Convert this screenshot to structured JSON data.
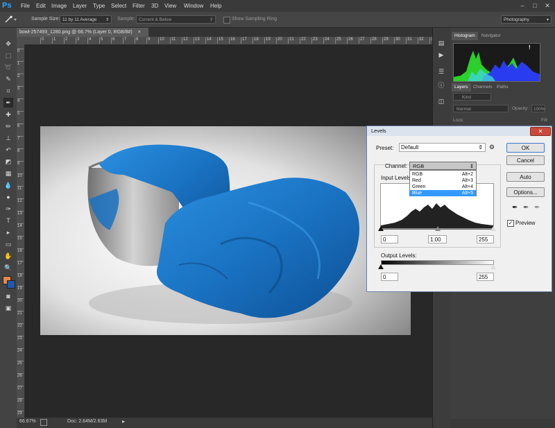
{
  "app": {
    "logo": "Ps",
    "menu": [
      "File",
      "Edit",
      "Image",
      "Layer",
      "Type",
      "Select",
      "Filter",
      "3D",
      "View",
      "Window",
      "Help"
    ],
    "window_controls": [
      "–",
      "□",
      "✕"
    ]
  },
  "options": {
    "sample_size_label": "Sample Size:",
    "sample_size_value": "11 by 11 Average",
    "sample_label": "Sample:",
    "sample_value": "Current & Below",
    "show_ring_label": "Show Sampling Ring",
    "workspace": "Photography"
  },
  "document": {
    "tab_title": "bowl-257493_1280.png @ 66.7% (Layer 0, RGB/8#)",
    "tab_close": "×",
    "ruler_h": [
      "0",
      "1",
      "2",
      "3",
      "4",
      "5",
      "6",
      "7",
      "8",
      "9",
      "10",
      "11",
      "12",
      "13",
      "14",
      "15",
      "16",
      "17",
      "18",
      "19",
      "20",
      "21",
      "22",
      "23",
      "24",
      "25",
      "26",
      "27",
      "28",
      "29",
      "30",
      "31",
      "32",
      "33"
    ],
    "ruler_v": [
      "0",
      "1",
      "2",
      "3",
      "4",
      "5",
      "6",
      "7",
      "8",
      "9",
      "10",
      "11",
      "12",
      "13",
      "14",
      "15",
      "16",
      "17",
      "18",
      "19",
      "20",
      "21",
      "22",
      "23",
      "24",
      "25",
      "26",
      "27",
      "28",
      "29"
    ]
  },
  "status": {
    "zoom": "66.67%",
    "doc_info": "Doc: 2.64M/2.63M",
    "arrow": "▸"
  },
  "panels": {
    "tabs_top": [
      "Histogram",
      "Navigator"
    ],
    "tabs_layers": [
      "Layers",
      "Channels",
      "Paths"
    ],
    "kind_label": "Kind",
    "blend_mode": "Normal",
    "opacity_label": "Opacity:",
    "opacity_value": "100%",
    "lock_label": "Lock:",
    "fill_label": "Fill:",
    "fill_value": "100%",
    "warning_icon": "!"
  },
  "levels": {
    "title": "Levels",
    "close": "✕",
    "preset_label": "Preset:",
    "preset_value": "Default",
    "channel_label": "Channel:",
    "channel_value": "RGB",
    "channel_options": [
      {
        "name": "RGB",
        "shortcut": "Alt+2"
      },
      {
        "name": "Red",
        "shortcut": "Alt+3"
      },
      {
        "name": "Green",
        "shortcut": "Alt+4"
      },
      {
        "name": "Blue",
        "shortcut": "Alt+5"
      }
    ],
    "selected_channel": "Blue",
    "input_levels_label": "Input Levels:",
    "input_black": "0",
    "input_gamma": "1.00",
    "input_white": "255",
    "output_levels_label": "Output Levels:",
    "output_black": "0",
    "output_white": "255",
    "buttons": {
      "ok": "OK",
      "cancel": "Cancel",
      "auto": "Auto",
      "options": "Options..."
    },
    "preview_label": "Preview",
    "preview_checked": true
  },
  "colors": {
    "foreground": "#e8884a",
    "background": "#1e5aa8",
    "accent_blue": "#3399ff",
    "cloth_blue": "#1a78c8"
  }
}
